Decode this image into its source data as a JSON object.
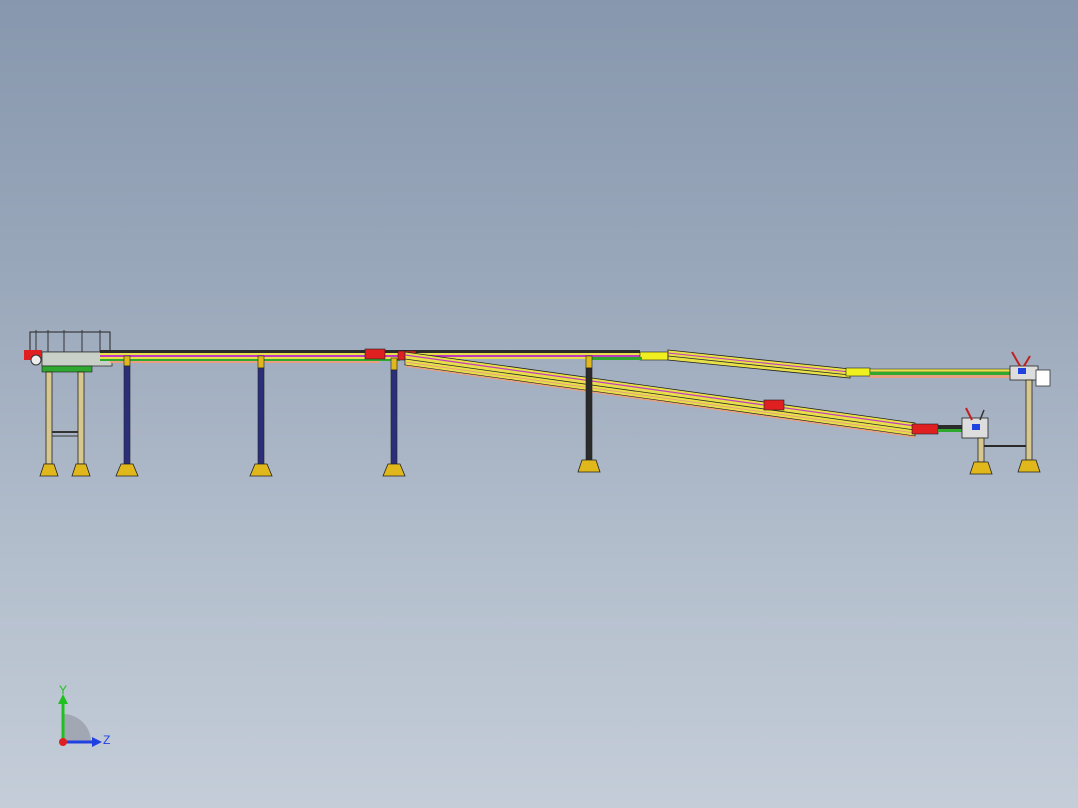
{
  "viewport": {
    "background_top": "#8797ad",
    "background_bottom": "#c4cdd8"
  },
  "model": {
    "colors": {
      "frame": "#2a2a2a",
      "leg": "#2b2f7a",
      "foot": "#e0b81c",
      "rail_yellow": "#e8e04a",
      "rail_green": "#2fa82f",
      "rail_magenta": "#c03ac0",
      "rail_salmon": "#e8a080",
      "block_red": "#e02020",
      "block_yellow": "#f0f020"
    },
    "icon": "conveyor-assembly-side-view"
  },
  "triad": {
    "y_label": "Y",
    "z_label": "Z",
    "y_color": "#20c020",
    "z_color": "#2040e0",
    "x_color": "#e02020"
  }
}
